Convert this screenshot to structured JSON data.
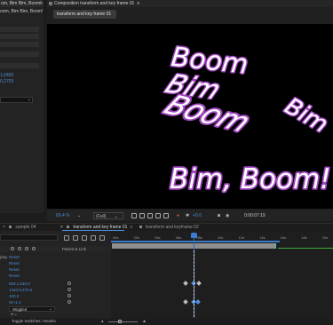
{
  "left_panel": {
    "tab_title": "om, Bim Bim, Boom!",
    "meta_line": "oom, Bim Bim, Boom!",
    "values": [
      "1,5402",
      "0,2703"
    ]
  },
  "comp_panel": {
    "tab_label": "Composition transform and key frame 01",
    "subtab_label": "transform and key frame 01",
    "canvas_lines": [
      "Boom",
      "Bim",
      "Boom",
      "Bim",
      "Bim, Boom!"
    ],
    "colors": {
      "outline": "#a346c2",
      "fill": "#ffffff",
      "background": "#000000"
    }
  },
  "comp_toolbar": {
    "zoom": "69.4 %",
    "resolution": "(Full)",
    "exposure": "+0.0",
    "timecode": "0:00:07:19"
  },
  "timeline": {
    "tabs": [
      {
        "label": "sample 04",
        "active": false
      },
      {
        "label": "transform and key frame 01",
        "active": true
      },
      {
        "label": "transform and keyframe 02",
        "active": false
      }
    ],
    "header": {
      "parent_link": "Parent & Link"
    },
    "rows": [
      {
        "prop": "play",
        "value": "Reset"
      },
      {
        "prop": "",
        "value": "Reset"
      },
      {
        "prop": "",
        "value": "Reset"
      },
      {
        "prop": "",
        "value": "Reset"
      },
      {
        "prop": "",
        "value": "683.1,540.0"
      },
      {
        "prop": "",
        "value": "1440.0,270.0"
      },
      {
        "prop": "",
        "value": "100.0"
      },
      {
        "prop": "",
        "value": "0x+1.2"
      }
    ],
    "wiggle_select": "Wiggled",
    "footer_label": "Toggle Switches / Modes",
    "ruler_ticks": [
      "00s",
      "02s",
      "04s",
      "06s",
      "08s",
      "10s",
      "12s",
      "14s",
      "16s",
      "18s",
      "20s"
    ],
    "current_time_fraction": 0.37
  }
}
